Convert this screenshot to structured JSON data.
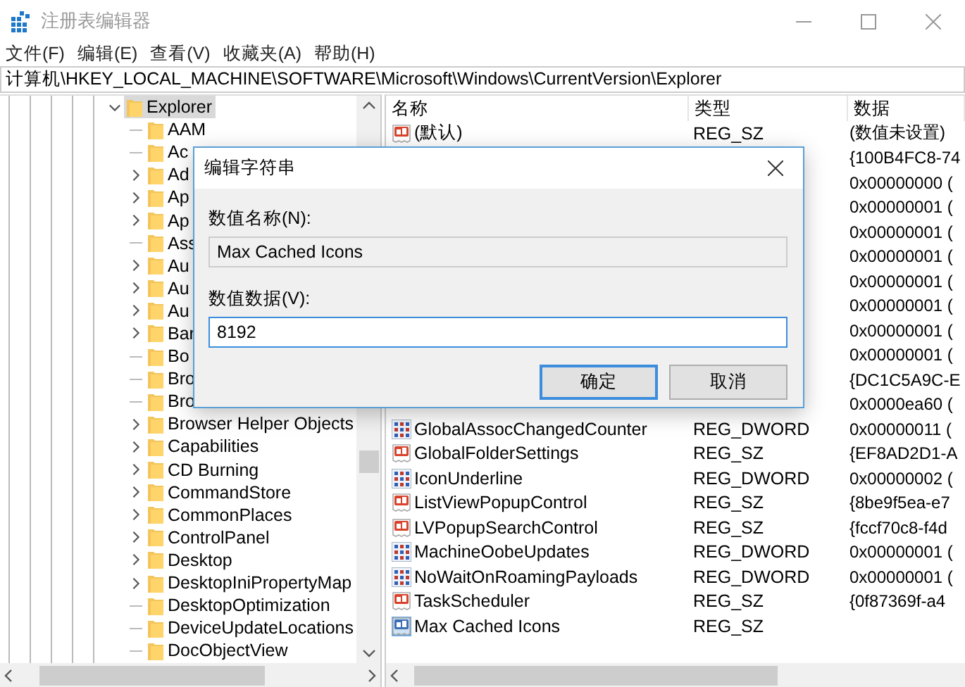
{
  "window": {
    "title": "注册表编辑器"
  },
  "menu": [
    "文件(F)",
    "编辑(E)",
    "查看(V)",
    "收藏夹(A)",
    "帮助(H)"
  ],
  "address": "计算机\\HKEY_LOCAL_MACHINE\\SOFTWARE\\Microsoft\\Windows\\CurrentVersion\\Explorer",
  "tree": {
    "label": "Explorer",
    "expanded": true,
    "selected": true,
    "children": [
      {
        "label": "AAM",
        "expandable": false,
        "selected": false
      },
      {
        "label": "Ac",
        "expandable": false,
        "selected": false
      },
      {
        "label": "Ad",
        "expandable": true,
        "selected": false
      },
      {
        "label": "Ap",
        "expandable": true,
        "selected": false
      },
      {
        "label": "Ap",
        "expandable": true,
        "selected": false
      },
      {
        "label": "Ass",
        "expandable": false,
        "selected": false
      },
      {
        "label": "Au",
        "expandable": true,
        "selected": false
      },
      {
        "label": "Au",
        "expandable": true,
        "selected": false
      },
      {
        "label": "Au",
        "expandable": true,
        "selected": false
      },
      {
        "label": "Bar",
        "expandable": true,
        "selected": false
      },
      {
        "label": "Bo",
        "expandable": false,
        "selected": false
      },
      {
        "label": "Bro",
        "expandable": false,
        "selected": false
      },
      {
        "label": "Bro",
        "expandable": false,
        "selected": false
      },
      {
        "label": "Browser Helper Objects",
        "expandable": true,
        "selected": false
      },
      {
        "label": "Capabilities",
        "expandable": true,
        "selected": false
      },
      {
        "label": "CD Burning",
        "expandable": true,
        "selected": false
      },
      {
        "label": "CommandStore",
        "expandable": true,
        "selected": false
      },
      {
        "label": "CommonPlaces",
        "expandable": true,
        "selected": false
      },
      {
        "label": "ControlPanel",
        "expandable": true,
        "selected": false
      },
      {
        "label": "Desktop",
        "expandable": true,
        "selected": false
      },
      {
        "label": "DesktopIniPropertyMap",
        "expandable": true,
        "selected": false
      },
      {
        "label": "DesktopOptimization",
        "expandable": false,
        "selected": false
      },
      {
        "label": "DeviceUpdateLocations",
        "expandable": false,
        "selected": false
      },
      {
        "label": "DocObjectView",
        "expandable": false,
        "selected": false
      }
    ]
  },
  "list": {
    "columns": [
      "名称",
      "类型",
      "数据"
    ],
    "rows": [
      {
        "kind": "string",
        "name": "(默认)",
        "type": "REG_SZ",
        "data": "(数值未设置)",
        "selected": false
      },
      {
        "data": "{100B4FC8-74",
        "selected": false
      },
      {
        "data": "0x00000000 (",
        "selected": false
      },
      {
        "data": "0x00000001 (",
        "selected": false
      },
      {
        "data": "0x00000001 (",
        "selected": false
      },
      {
        "data": "0x00000001 (",
        "selected": false
      },
      {
        "data": "0x00000001 (",
        "selected": false
      },
      {
        "data": "0x00000001 (",
        "selected": false
      },
      {
        "data": "0x00000001 (",
        "selected": false
      },
      {
        "data": "0x00000001 (",
        "selected": false
      },
      {
        "data": "{DC1C5A9C-E",
        "selected": false
      },
      {
        "data": "0x0000ea60 (",
        "selected": false
      },
      {
        "kind": "dword",
        "name": "GlobalAssocChangedCounter",
        "type": "REG_DWORD",
        "data": "0x00000011 (",
        "selected": false
      },
      {
        "kind": "string",
        "name": "GlobalFolderSettings",
        "type": "REG_SZ",
        "data": "{EF8AD2D1-A",
        "selected": false
      },
      {
        "kind": "dword",
        "name": "IconUnderline",
        "type": "REG_DWORD",
        "data": "0x00000002 (",
        "selected": false
      },
      {
        "kind": "string",
        "name": "ListViewPopupControl",
        "type": "REG_SZ",
        "data": "{8be9f5ea-e7",
        "selected": false
      },
      {
        "kind": "string",
        "name": "LVPopupSearchControl",
        "type": "REG_SZ",
        "data": "{fccf70c8-f4d",
        "selected": false
      },
      {
        "kind": "dword",
        "name": "MachineOobeUpdates",
        "type": "REG_DWORD",
        "data": "0x00000001 (",
        "selected": false
      },
      {
        "kind": "dword",
        "name": "NoWaitOnRoamingPayloads",
        "type": "REG_DWORD",
        "data": "0x00000001 (",
        "selected": false
      },
      {
        "kind": "string",
        "name": "TaskScheduler",
        "type": "REG_SZ",
        "data": "{0f87369f-a4",
        "selected": false
      },
      {
        "kind": "string",
        "name": "Max Cached Icons",
        "type": "REG_SZ",
        "selected": true
      }
    ]
  },
  "dialog": {
    "title": "编辑字符串",
    "name_label": "数值名称(N):",
    "name_value": "Max Cached Icons",
    "data_label": "数值数据(V):",
    "data_value": "8192",
    "buttons": [
      {
        "label": "确定",
        "default": true
      },
      {
        "label": "取消",
        "default": false
      }
    ]
  }
}
